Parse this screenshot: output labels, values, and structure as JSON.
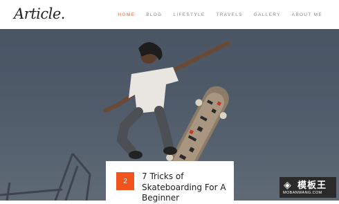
{
  "header": {
    "logo": "Article.",
    "nav": [
      {
        "label": "HOME",
        "active": true
      },
      {
        "label": "BLOG"
      },
      {
        "label": "LIFESTYLE"
      },
      {
        "label": "TRAVELS"
      },
      {
        "label": "GALLERY"
      },
      {
        "label": "ABOUT ME"
      }
    ]
  },
  "hero": {
    "image": "skateboarder-jump-photo"
  },
  "featured": {
    "number": "2",
    "title": "7 Tricks of Skateboarding For A Beginner"
  },
  "watermark": {
    "title": "模板王",
    "url": "MOBANWANG.COM"
  },
  "colors": {
    "accent": "#f26b3a",
    "badge": "#f0541c"
  }
}
